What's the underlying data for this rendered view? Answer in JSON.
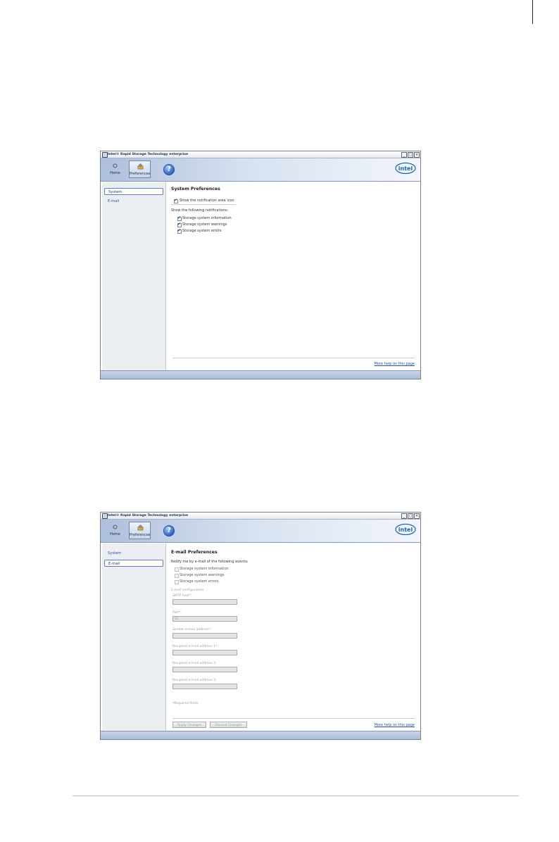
{
  "app": {
    "title": "Intel® Rapid Storage Technology enterprise",
    "window_buttons": [
      "_",
      "□",
      "×"
    ],
    "toolbar": {
      "home_label": "Home",
      "preferences_label": "Preferences",
      "help_icon": "?"
    },
    "logo_text": "intel"
  },
  "window1": {
    "sidebar": [
      {
        "label": "System",
        "selected": true
      },
      {
        "label": "E-mail",
        "selected": false
      }
    ],
    "heading": "System Preferences",
    "show_icon": {
      "label": "Show the notification area icon",
      "checked": true
    },
    "notify_heading": "Show the following notifications:",
    "notifications": [
      {
        "label": "Storage system information",
        "checked": true
      },
      {
        "label": "Storage system warnings",
        "checked": true
      },
      {
        "label": "Storage system errors",
        "checked": true
      }
    ],
    "more_help": "More help on this page"
  },
  "window2": {
    "sidebar": [
      {
        "label": "System",
        "selected": false
      },
      {
        "label": "E-mail",
        "selected": true
      }
    ],
    "heading": "E-mail Preferences",
    "notify_heading": "Notify me by e-mail of the following events:",
    "events": [
      {
        "label": "Storage system information",
        "checked": false
      },
      {
        "label": "Storage system warnings",
        "checked": false
      },
      {
        "label": "Storage system errors",
        "checked": false
      }
    ],
    "config_heading": "E-mail configuration",
    "fields": [
      {
        "label": "SMTP host*:",
        "value": ""
      },
      {
        "label": "Port*:",
        "value": "25"
      },
      {
        "label": "Sender e-mail address*:",
        "value": ""
      },
      {
        "label": "Recipient e-mail address 1*:",
        "value": ""
      },
      {
        "label": "Recipient e-mail address 2:",
        "value": ""
      },
      {
        "label": "Recipient e-mail address 3:",
        "value": ""
      }
    ],
    "required_note": "*Required fields",
    "apply_label": "Apply Changes",
    "discard_label": "Discard Changes",
    "more_help": "More help on this page"
  }
}
